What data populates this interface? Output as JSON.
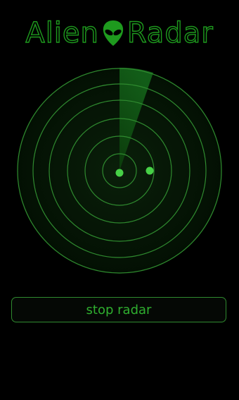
{
  "app": {
    "title_part1": "Alien",
    "title_part2": "Radar",
    "logo_icon": "alien-head-icon"
  },
  "controls": {
    "stop_label": "stop radar"
  },
  "colors": {
    "background": "#000000",
    "accent": "#1e9a1e",
    "ring": "#2f8a2f",
    "sweep": "#0d4a0d",
    "blip": "#47d147"
  },
  "radar": {
    "ring_count": 6,
    "sweep_angle_from_deg": 0,
    "sweep_angle_to_deg": 22,
    "blips": [
      {
        "id": "center"
      },
      {
        "id": "contact"
      }
    ]
  }
}
